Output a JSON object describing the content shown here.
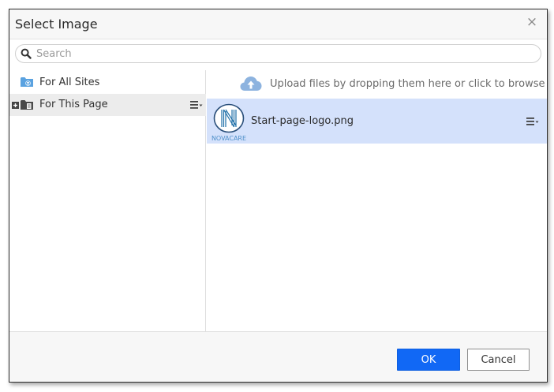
{
  "dialog": {
    "title": "Select Image",
    "close_glyph": "×"
  },
  "search": {
    "placeholder": "Search",
    "value": ""
  },
  "tree": {
    "items": [
      {
        "label": "For All Sites",
        "icon": "site-folder-icon",
        "selected": false
      },
      {
        "label": "For This Page",
        "icon": "page-folder-icon",
        "selected": true,
        "expandable": true
      }
    ]
  },
  "upload": {
    "text": "Upload files by dropping them here or click to browse",
    "icon": "cloud-upload-icon"
  },
  "files": [
    {
      "name": "Start-page-logo.png",
      "thumb_caption": "NOVACARE",
      "selected": true
    }
  ],
  "footer": {
    "ok_label": "OK",
    "cancel_label": "Cancel"
  },
  "colors": {
    "accent": "#1168f5",
    "selected_row": "#d4e1fb",
    "folder": "#5aa2e0"
  }
}
